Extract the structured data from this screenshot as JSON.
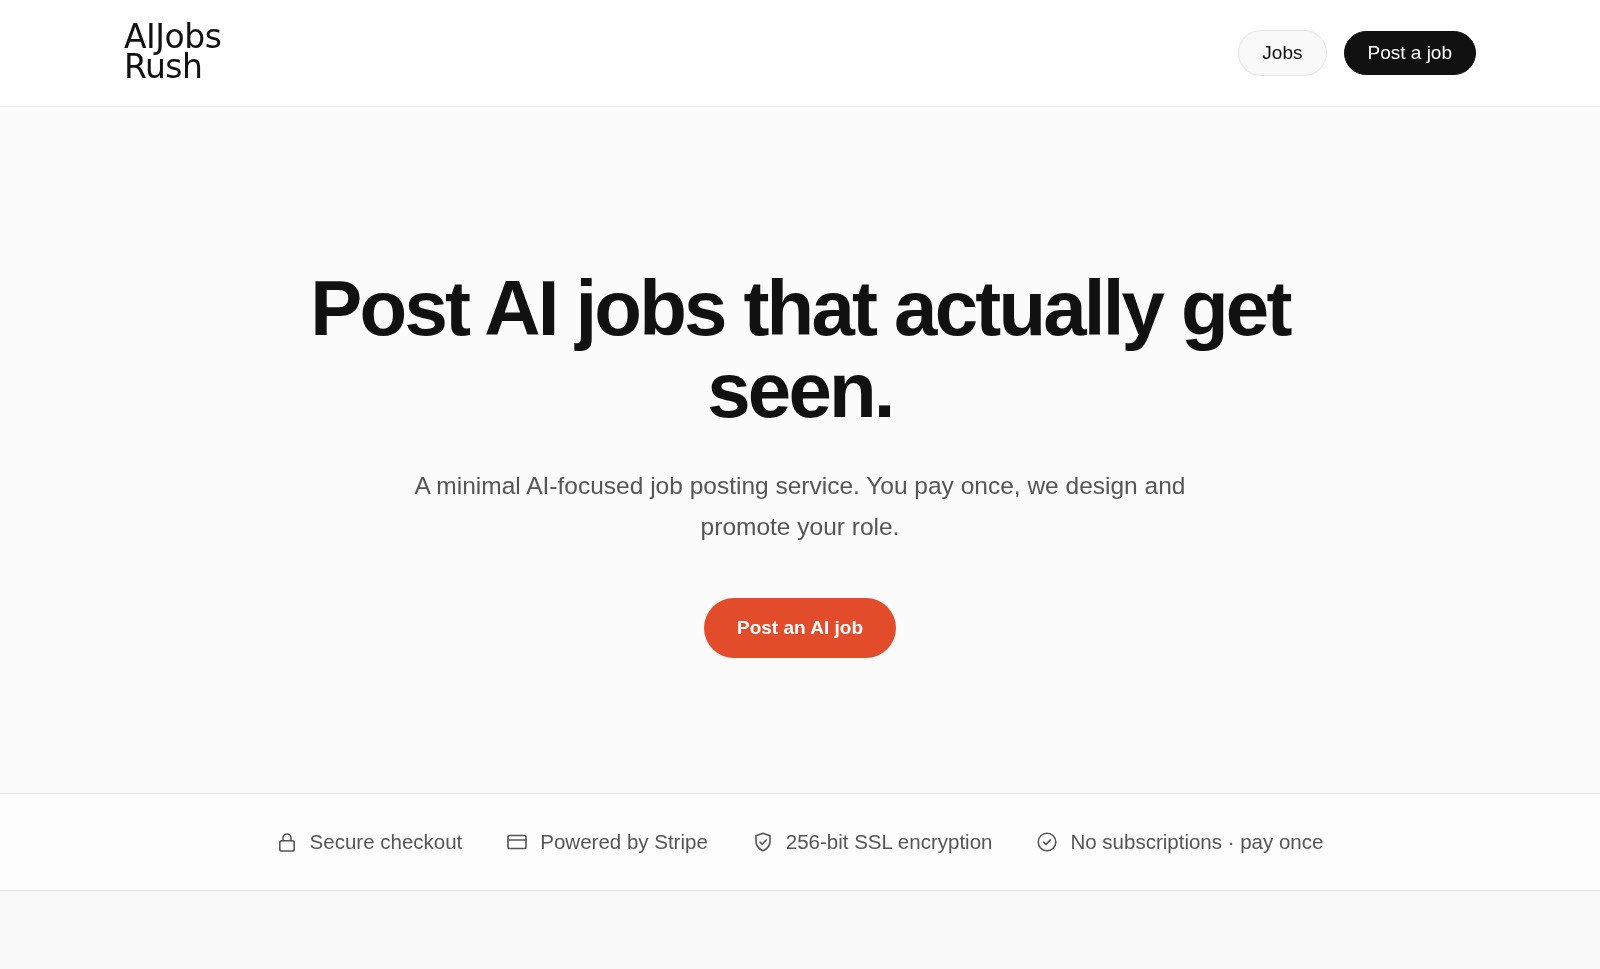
{
  "header": {
    "logo": [
      "AIJobs",
      "Rush"
    ],
    "nav": [
      {
        "label": "Jobs",
        "kind": "secondary"
      },
      {
        "label": "Post a job",
        "kind": "primary"
      }
    ]
  },
  "hero": {
    "title": "Post AI jobs that actually get seen.",
    "subtitle": "A minimal AI-focused job posting service. You pay once, we design and promote your role.",
    "cta": "Post an AI job"
  },
  "trust_bar": [
    {
      "label": "Secure checkout"
    },
    {
      "label": "Powered by Stripe"
    },
    {
      "label": "256-bit SSL encryption"
    },
    {
      "label": "No subscriptions · pay once"
    }
  ]
}
